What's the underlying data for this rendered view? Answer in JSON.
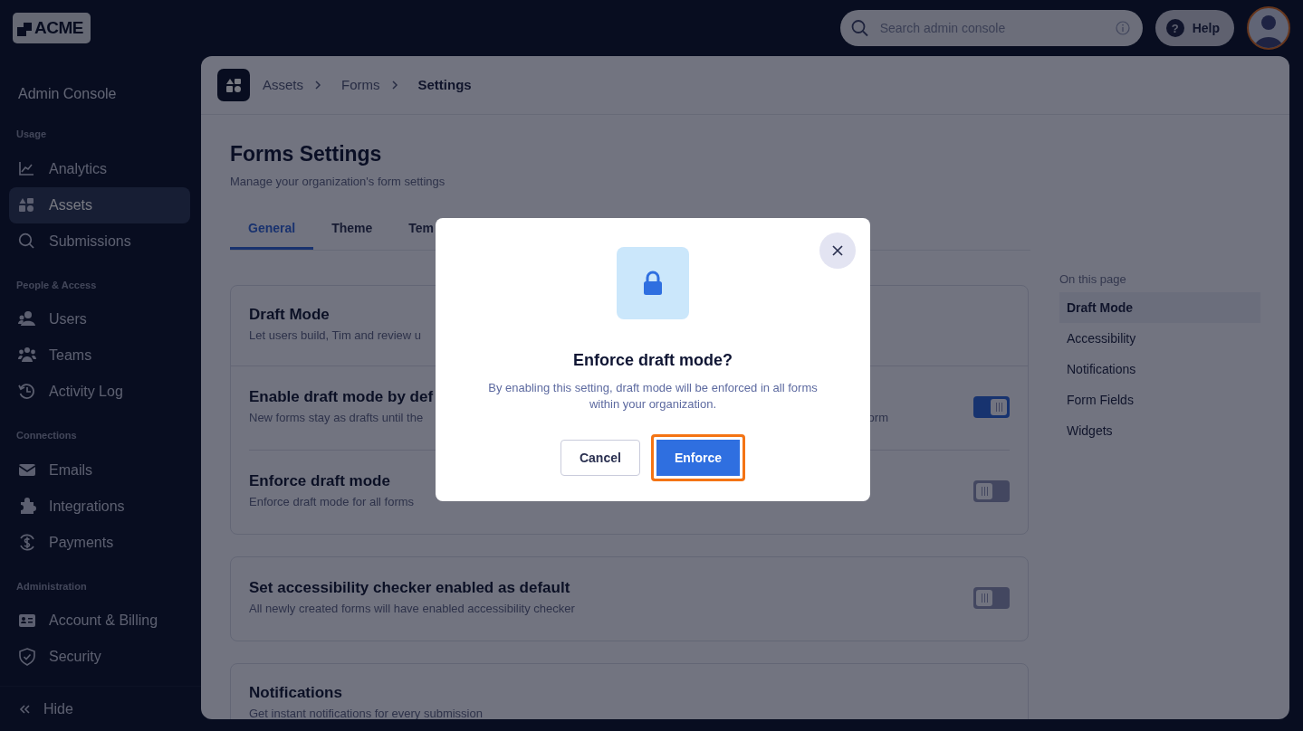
{
  "brand": {
    "logo_text": "ACME"
  },
  "search": {
    "placeholder": "Search admin console"
  },
  "help_button": {
    "icon_glyph": "?",
    "label": "Help"
  },
  "sidebar": {
    "title": "Admin Console",
    "sections": [
      {
        "heading": "Usage",
        "items": [
          {
            "label": "Analytics",
            "selected": false
          },
          {
            "label": "Assets",
            "selected": true
          },
          {
            "label": "Submissions",
            "selected": false
          }
        ]
      },
      {
        "heading": "People & Access",
        "items": [
          {
            "label": "Users",
            "selected": false
          },
          {
            "label": "Teams",
            "selected": false
          },
          {
            "label": "Activity Log",
            "selected": false
          }
        ]
      },
      {
        "heading": "Connections",
        "items": [
          {
            "label": "Emails",
            "selected": false
          },
          {
            "label": "Integrations",
            "selected": false
          },
          {
            "label": "Payments",
            "selected": false
          }
        ]
      },
      {
        "heading": "Administration",
        "items": [
          {
            "label": "Account & Billing",
            "selected": false
          },
          {
            "label": "Security",
            "selected": false
          }
        ]
      }
    ],
    "hide_label": "Hide"
  },
  "breadcrumb": [
    "Assets",
    "Forms",
    "Settings"
  ],
  "page": {
    "title": "Forms Settings",
    "subtitle": "Manage your organization's form settings"
  },
  "tabs": [
    {
      "label": "General",
      "selected": true
    },
    {
      "label": "Theme",
      "selected": false
    },
    {
      "label": "Tem",
      "selected": false
    }
  ],
  "cards": [
    {
      "title": "Draft Mode",
      "description": "Let users build, Tim and review u",
      "settings": [
        {
          "title": "Enable draft mode by def",
          "description": "New forms stay as drafts until the",
          "description_tail": "orm",
          "on": true
        },
        {
          "title": "Enforce draft mode",
          "description": "Enforce draft mode for all forms",
          "on": false
        }
      ]
    },
    {
      "settings": [
        {
          "title": "Set accessibility checker enabled as default",
          "description": "All newly created forms will have enabled accessibility checker",
          "on": false
        }
      ]
    },
    {
      "title": "Notifications",
      "description": "Get instant notifications for every submission"
    }
  ],
  "toc": {
    "heading": "On this page",
    "items": [
      {
        "label": "Draft Mode",
        "selected": true
      },
      {
        "label": "Accessibility",
        "selected": false
      },
      {
        "label": "Notifications",
        "selected": false
      },
      {
        "label": "Form Fields",
        "selected": false
      },
      {
        "label": "Widgets",
        "selected": false
      }
    ]
  },
  "modal": {
    "title": "Enforce draft mode?",
    "message": "By enabling this setting, draft mode will be enforced in all forms within your organization.",
    "buttons": [
      {
        "label": "Cancel",
        "kind": "secondary",
        "focused": false
      },
      {
        "label": "Enforce",
        "kind": "primary",
        "focused": true
      }
    ]
  }
}
